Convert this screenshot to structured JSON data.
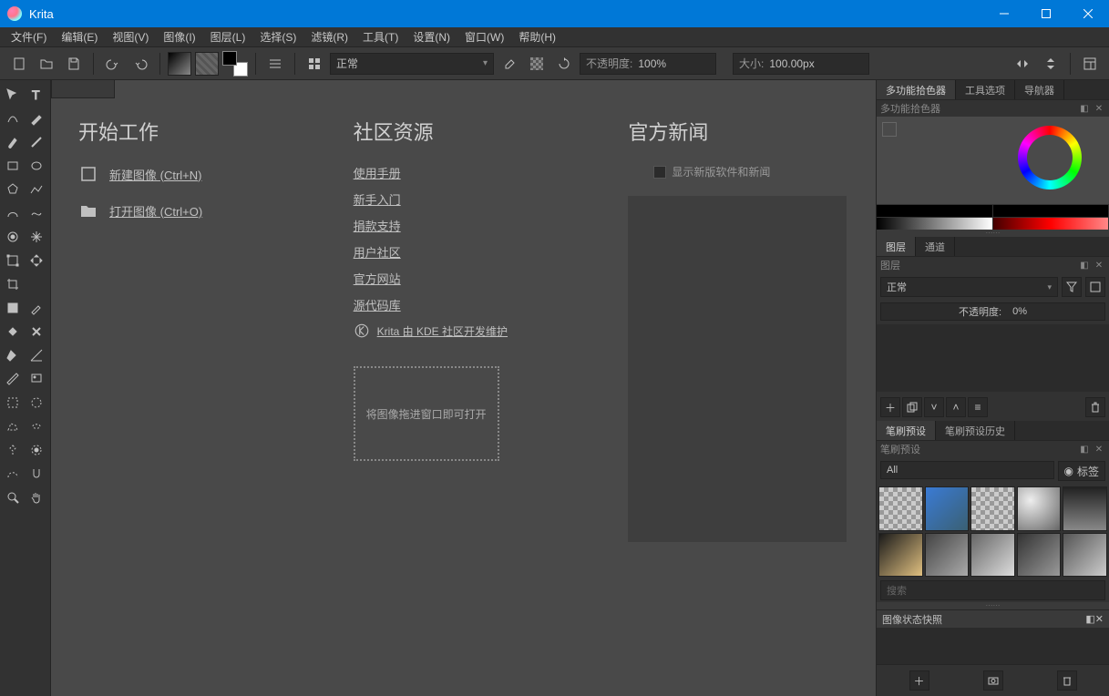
{
  "app": {
    "title": "Krita"
  },
  "menu": [
    "文件(F)",
    "编辑(E)",
    "视图(V)",
    "图像(I)",
    "图层(L)",
    "选择(S)",
    "滤镜(R)",
    "工具(T)",
    "设置(N)",
    "窗口(W)",
    "帮助(H)"
  ],
  "toolbar": {
    "blend_mode": "正常",
    "opacity_label": "不透明度:",
    "opacity_value": "100%",
    "size_label": "大小:",
    "size_value": "100.00px"
  },
  "welcome": {
    "start_title": "开始工作",
    "new_image": "新建图像 (Ctrl+N)",
    "open_image": "打开图像 (Ctrl+O)",
    "community_title": "社区资源",
    "links": [
      "使用手册",
      "新手入门",
      "捐款支持",
      "用户社区",
      "官方网站",
      "源代码库"
    ],
    "kde_line": "Krita 由 KDE 社区开发维护",
    "dropzone": "将图像拖进窗口即可打开",
    "news_title": "官方新闻",
    "news_check": "显示新版软件和新闻"
  },
  "dockers": {
    "top_tabs": [
      "多功能拾色器",
      "工具选项",
      "导航器"
    ],
    "color_title": "多功能拾色器",
    "layer_tabs": [
      "图层",
      "通道"
    ],
    "layer_title": "图层",
    "layer_blend": "正常",
    "layer_opacity_label": "不透明度:",
    "layer_opacity_value": "0%",
    "preset_tabs": [
      "笔刷预设",
      "笔刷预设历史"
    ],
    "preset_title": "笔刷预设",
    "preset_filter": "All",
    "preset_tag": "标签",
    "preset_search": "搜索",
    "snapshot_title": "图像状态快照"
  }
}
